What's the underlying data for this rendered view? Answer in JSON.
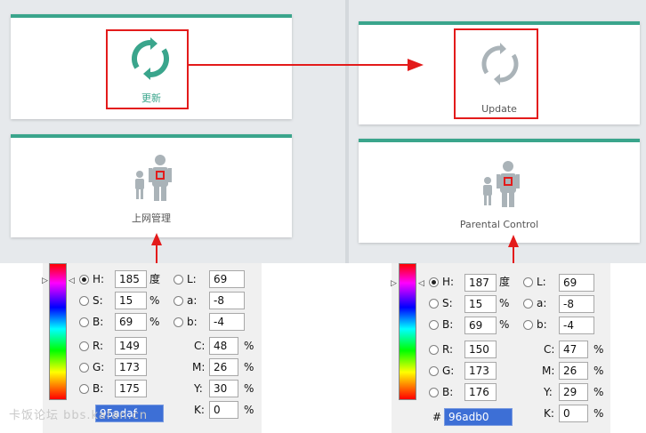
{
  "colors": {
    "accent": "#3aa58c",
    "annotation": "#e31b1b",
    "icon_gray": "#aab3b8"
  },
  "left": {
    "update_label": "更新",
    "parental_label": "上网管理",
    "picker": {
      "H": "185",
      "S": "15",
      "B": "69",
      "L": "69",
      "a": "-8",
      "b": "-4",
      "R": "149",
      "G": "173",
      "B2": "175",
      "C": "48",
      "M": "26",
      "Y": "30",
      "K": "0",
      "hex": "95adaf"
    }
  },
  "right": {
    "update_label": "Update",
    "parental_label": "Parental Control",
    "picker": {
      "H": "187",
      "S": "15",
      "B": "69",
      "L": "69",
      "a": "-8",
      "b": "-4",
      "R": "150",
      "G": "173",
      "B2": "176",
      "C": "47",
      "M": "26",
      "Y": "29",
      "K": "0",
      "hex": "96adb0"
    }
  },
  "labels": {
    "H": "H:",
    "S": "S:",
    "B": "B:",
    "L": "L:",
    "a": "a:",
    "b": "b:",
    "R": "R:",
    "G": "G:",
    "C": "C:",
    "M": "M:",
    "Y": "Y:",
    "K": "K:",
    "deg": "度",
    "pct": "%",
    "hash": "#"
  },
  "watermark": "卡饭论坛 bbs.kafan.cn"
}
